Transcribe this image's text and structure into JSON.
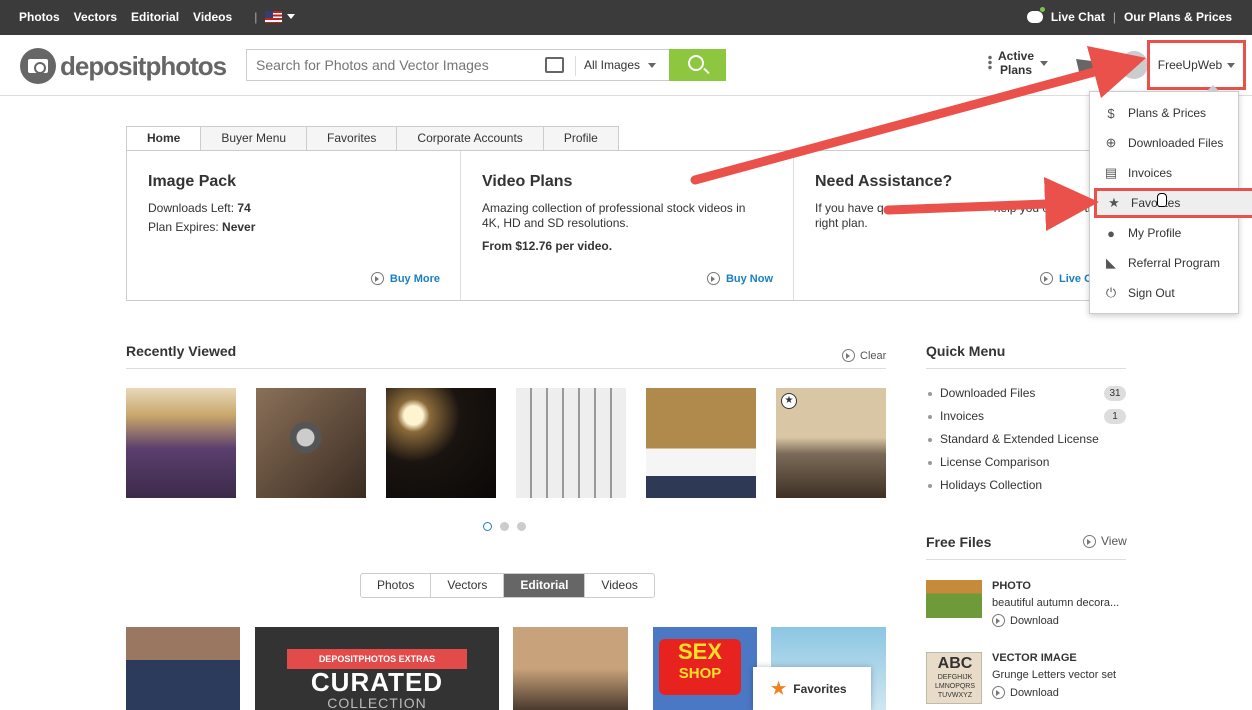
{
  "topbar": {
    "nav": [
      "Photos",
      "Vectors",
      "Editorial",
      "Videos"
    ],
    "separator": "|",
    "live_chat": "Live Chat",
    "divider": "|",
    "plans_prices": "Our Plans & Prices"
  },
  "header": {
    "logo_text": "depositphotos",
    "search_placeholder": "Search for Photos and Vector Images",
    "filter": "All Images",
    "active_plans": [
      "Active",
      "Plans"
    ],
    "username": "FreeUpWeb"
  },
  "dashboard": {
    "tabs": [
      "Home",
      "Buyer Menu",
      "Favorites",
      "Corporate Accounts",
      "Profile"
    ],
    "image_pack": {
      "title": "Image Pack",
      "downloads_label": "Downloads Left: ",
      "downloads_value": "74",
      "expires_label": "Plan Expires: ",
      "expires_value": "Never",
      "cta": "Buy More"
    },
    "video_plans": {
      "title": "Video Plans",
      "desc": "Amazing collection of professional stock videos in 4K, HD and SD resolutions.",
      "price": "From $12.76 per video.",
      "cta": "Buy Now"
    },
    "assistance": {
      "title": "Need Assistance?",
      "desc_a": "If you have q",
      "desc_b": "help you choose the",
      "desc_c": "right plan.",
      "cta": "Live Ch"
    }
  },
  "recently_viewed": {
    "title": "Recently Viewed",
    "clear": "Clear"
  },
  "media_tabs": [
    "Photos",
    "Vectors",
    "Editorial",
    "Videos"
  ],
  "promo": {
    "banner_small": "DEPOSITPHOTOS EXTRAS",
    "banner_big": "CURATED",
    "banner_sub": "COLLECTION",
    "sign_top": "SEX",
    "sign_bottom": "SHOP"
  },
  "quick_menu": {
    "title": "Quick Menu",
    "items": [
      {
        "label": "Downloaded Files",
        "badge": "31"
      },
      {
        "label": "Invoices",
        "badge": "1"
      },
      {
        "label": "Standard & Extended License",
        "badge": ""
      },
      {
        "label": "License Comparison",
        "badge": ""
      },
      {
        "label": "Holidays Collection",
        "badge": ""
      }
    ]
  },
  "free_files": {
    "title": "Free Files",
    "view": "View",
    "items": [
      {
        "type": "PHOTO",
        "desc": "beautiful autumn decora...",
        "action": "Download"
      },
      {
        "type": "VECTOR IMAGE",
        "desc": "Grunge Letters vector set",
        "action": "Download",
        "thumb_text": "ABC",
        "thumb_sub_a": "DEFGHIJK",
        "thumb_sub_b": "LMNOPQRS",
        "thumb_sub_c": "TUVWXYZ"
      }
    ]
  },
  "favorites_tab": "Favorites",
  "user_menu": [
    {
      "label": "Plans & Prices",
      "icon": "dollar-icon",
      "glyph": "$"
    },
    {
      "label": "Downloaded Files",
      "icon": "download-icon",
      "glyph": "⊕"
    },
    {
      "label": "Invoices",
      "icon": "document-icon",
      "glyph": "▤"
    },
    {
      "label": "Favorites",
      "icon": "star-icon",
      "glyph": "★"
    },
    {
      "label": "My Profile",
      "icon": "user-icon",
      "glyph": "●"
    },
    {
      "label": "Referral Program",
      "icon": "megaphone-icon",
      "glyph": "◣"
    },
    {
      "label": "Sign Out",
      "icon": "power-icon",
      "glyph": "⏻"
    }
  ],
  "colors": {
    "accent_green": "#8dc63f",
    "link_blue": "#1a7fc1",
    "annotation_red": "#e9514a"
  }
}
